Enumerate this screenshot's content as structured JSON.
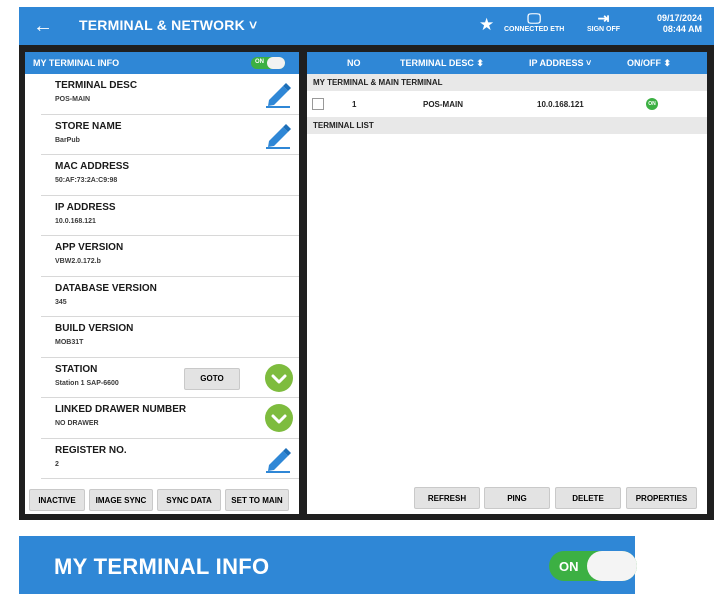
{
  "topbar": {
    "back_icon": "arrow-left-icon",
    "title": "TERMINAL & NETWORK ˅",
    "star_icon": "star-icon",
    "connected_label": "CONNECTED ETH",
    "signoff_label": "SIGN OFF",
    "date": "09/17/2024",
    "time": "08:44 AM"
  },
  "left_panel": {
    "header": "MY TERMINAL INFO",
    "toggle_label": "ON",
    "rows": [
      {
        "label": "TERMINAL DESC",
        "value": "POS-MAIN",
        "action": "pencil-icon"
      },
      {
        "label": "STORE NAME",
        "value": "BarPub",
        "action": "pencil-icon"
      },
      {
        "label": "MAC ADDRESS",
        "value": "50:AF:73:2A:C9:98",
        "action": ""
      },
      {
        "label": "IP ADDRESS",
        "value": "10.0.168.121",
        "action": ""
      },
      {
        "label": "APP VERSION",
        "value": "VBW2.0.172.b",
        "action": ""
      },
      {
        "label": "DATABASE VERSION",
        "value": "345",
        "action": ""
      },
      {
        "label": "BUILD VERSION",
        "value": "MOB31T",
        "action": ""
      },
      {
        "label": "STATION",
        "value": "Station 1 SAP-6600",
        "action": "check-icon",
        "button": "GOTO"
      },
      {
        "label": "LINKED DRAWER NUMBER",
        "value": "NO DRAWER",
        "action": "check-icon"
      },
      {
        "label": "REGISTER NO.",
        "value": "2",
        "action": "pencil-icon"
      }
    ],
    "buttons": [
      "INACTIVE",
      "IMAGE SYNC",
      "SYNC DATA",
      "SET TO MAIN"
    ]
  },
  "right_panel": {
    "columns": [
      "NO",
      "TERMINAL DESC ⬍",
      "IP ADDRESS ˅",
      "ON/OFF ⬍"
    ],
    "section_main": "MY TERMINAL & MAIN TERMINAL",
    "main_row": {
      "no": "1",
      "desc": "POS-MAIN",
      "ip": "10.0.168.121",
      "status": "ON"
    },
    "section_list": "TERMINAL LIST",
    "buttons": [
      "REFRESH",
      "PING",
      "DELETE",
      "PROPERTIES"
    ]
  },
  "zoom_callout": {
    "label": "MY TERMINAL INFO",
    "toggle_label": "ON"
  },
  "colors": {
    "accent": "#2f87d6",
    "on_green": "#3cb043",
    "check_green": "#7ebc3e",
    "pencil_blue": "#2f87d6"
  }
}
